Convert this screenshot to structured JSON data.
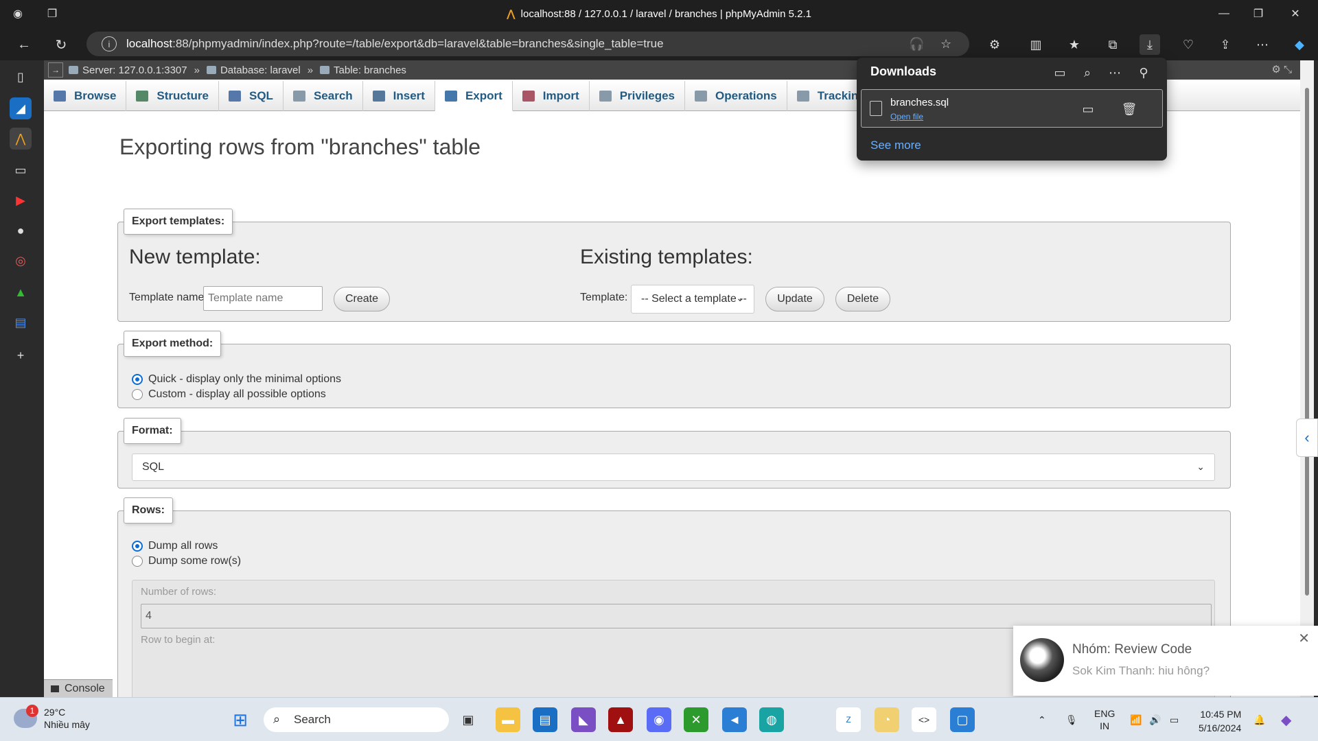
{
  "window": {
    "title": "localhost:88 / 127.0.0.1 / laravel / branches | phpMyAdmin 5.2.1"
  },
  "browser": {
    "url_host": "localhost",
    "url_rest": ":88/phpmyadmin/index.php?route=/table/export&db=laravel&table=branches&single_table=true"
  },
  "breadcrumb": {
    "server": "Server: 127.0.0.1:3307",
    "database": "Database: laravel",
    "table": "Table: branches",
    "sep": "»"
  },
  "tabs": [
    {
      "label": "Browse",
      "color": "#5577aa"
    },
    {
      "label": "Structure",
      "color": "#558866"
    },
    {
      "label": "SQL",
      "color": "#5577aa"
    },
    {
      "label": "Search",
      "color": "#8899aa"
    },
    {
      "label": "Insert",
      "color": "#557799"
    },
    {
      "label": "Export",
      "color": "#4477aa"
    },
    {
      "label": "Import",
      "color": "#aa5566"
    },
    {
      "label": "Privileges",
      "color": "#8899aa"
    },
    {
      "label": "Operations",
      "color": "#8899aa"
    },
    {
      "label": "Tracking",
      "color": "#8899aa"
    }
  ],
  "page_title": "Exporting rows from \"branches\" table",
  "export_templates": {
    "legend": "Export templates:",
    "new_heading": "New template:",
    "name_label": "Template name",
    "name_placeholder": "Template name",
    "create_label": "Create",
    "existing_heading": "Existing templates:",
    "template_label": "Template:",
    "select_value": "-- Select a template --",
    "update_label": "Update",
    "delete_label": "Delete"
  },
  "export_method": {
    "legend": "Export method:",
    "options": [
      {
        "label": "Quick - display only the minimal options",
        "checked": true
      },
      {
        "label": "Custom - display all possible options",
        "checked": false
      }
    ]
  },
  "format": {
    "legend": "Format:",
    "value": "SQL"
  },
  "rows": {
    "legend": "Rows:",
    "options": [
      {
        "label": "Dump all rows",
        "checked": true
      },
      {
        "label": "Dump some row(s)",
        "checked": false
      }
    ],
    "num_rows_label": "Number of rows:",
    "num_rows_value": "4",
    "row_begin_label": "Row to begin at:"
  },
  "console_label": "Console",
  "downloads": {
    "title": "Downloads",
    "filename": "branches.sql",
    "open_file": "Open file",
    "see_more": "See more"
  },
  "toast": {
    "title": "Nhóm: Review Code",
    "message": "Sok Kim Thanh: hiu hông?"
  },
  "taskbar": {
    "temperature": "29°C",
    "weather": "Nhiều mây",
    "weather_badge": "1",
    "search": "Search",
    "lang_top": "ENG",
    "lang_bottom": "IN",
    "time": "10:45 PM",
    "date": "5/16/2024"
  }
}
